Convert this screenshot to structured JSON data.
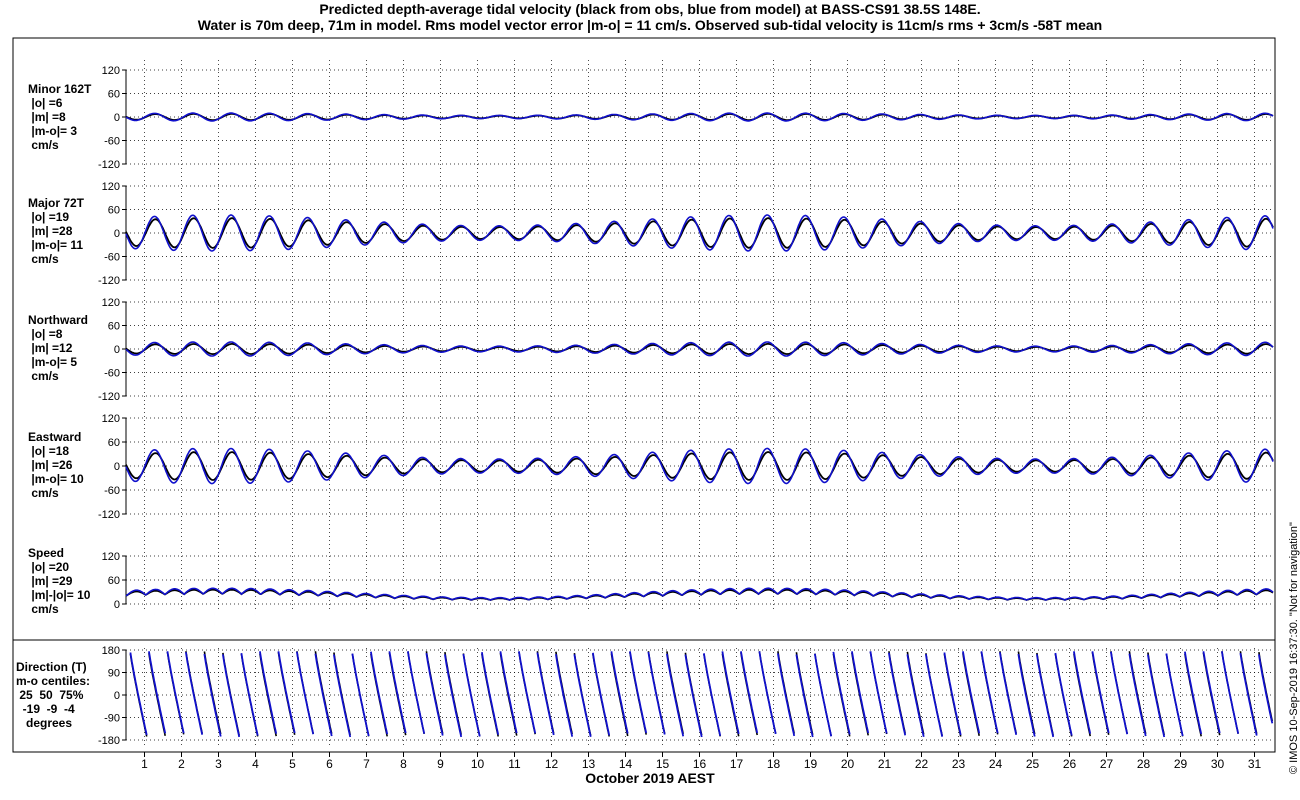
{
  "title": {
    "line1": "Predicted depth-average tidal velocity (black from obs, blue from model) at BASS-CS91 38.5S 148E.",
    "line2": "Water is 70m deep, 71m in model. Rms model vector error |m-o| = 11 cm/s. Observed sub-tidal velocity is 11cm/s rms + 3cm/s -58T mean"
  },
  "credit": "© IMOS 10-Sep-2019 16:37:30. \"Not for navigation\"",
  "colors": {
    "obs": "#000000",
    "model": "#1010cc"
  },
  "chart_data": {
    "type": "line",
    "xlabel": "October 2019 AEST",
    "x_ticks": [
      "1",
      "2",
      "3",
      "4",
      "5",
      "6",
      "7",
      "8",
      "9",
      "10",
      "11",
      "12",
      "13",
      "14",
      "15",
      "16",
      "17",
      "18",
      "19",
      "20",
      "21",
      "22",
      "23",
      "24",
      "25",
      "26",
      "27",
      "28",
      "29",
      "30",
      "31"
    ],
    "xlim_days": [
      0.5,
      31.5
    ],
    "grid": "dotted",
    "series": [
      {
        "name": "obs",
        "color": "#000000"
      },
      {
        "name": "model",
        "color": "#1010cc"
      }
    ],
    "panels": [
      {
        "key": "minor",
        "label_lines": [
          "Minor 162T",
          " |o| =6",
          " |m| =8",
          " |m-o|= 3",
          " cm/s"
        ],
        "ylim": [
          -120,
          120
        ],
        "yticks": [
          "120",
          "60",
          "0",
          "-60",
          "-120"
        ],
        "amp_obs": 8,
        "amp_model": 10,
        "mean": 0
      },
      {
        "key": "major",
        "label_lines": [
          "Major 72T",
          " |o| =19",
          " |m| =28",
          " |m-o|= 11",
          " cm/s"
        ],
        "ylim": [
          -120,
          120
        ],
        "yticks": [
          "120",
          "60",
          "0",
          "-60",
          "-120"
        ],
        "amp_obs": 38,
        "amp_model": 46,
        "mean": 0
      },
      {
        "key": "north",
        "label_lines": [
          "Northward",
          " |o| =8",
          " |m| =12",
          " |m-o|= 5",
          " cm/s"
        ],
        "ylim": [
          -120,
          120
        ],
        "yticks": [
          "120",
          "60",
          "0",
          "-60",
          "-120"
        ],
        "amp_obs": 13,
        "amp_model": 18,
        "mean": 0
      },
      {
        "key": "east",
        "label_lines": [
          "Eastward",
          " |o| =18",
          " |m| =26",
          " |m-o|= 10",
          " cm/s"
        ],
        "ylim": [
          -120,
          120
        ],
        "yticks": [
          "120",
          "60",
          "0",
          "-60",
          "-120"
        ],
        "amp_obs": 35,
        "amp_model": 44,
        "mean": 0
      },
      {
        "key": "speed",
        "label_lines": [
          "Speed",
          " |o| =20",
          " |m| =29",
          " |m|-|o|= 10",
          " cm/s"
        ],
        "ylim": [
          0,
          120
        ],
        "yticks": [
          "120",
          "60",
          "0"
        ],
        "amp_obs": 12,
        "amp_model": 16,
        "mean": 25
      },
      {
        "key": "direction",
        "label_lines": [
          "Direction (T)",
          "m-o centiles:",
          " 25  50  75%",
          "  -19  -9  -4",
          "   degrees"
        ],
        "ylim": [
          -180,
          180
        ],
        "yticks": [
          "180",
          "90",
          "0",
          "-90",
          "-180"
        ]
      }
    ]
  }
}
